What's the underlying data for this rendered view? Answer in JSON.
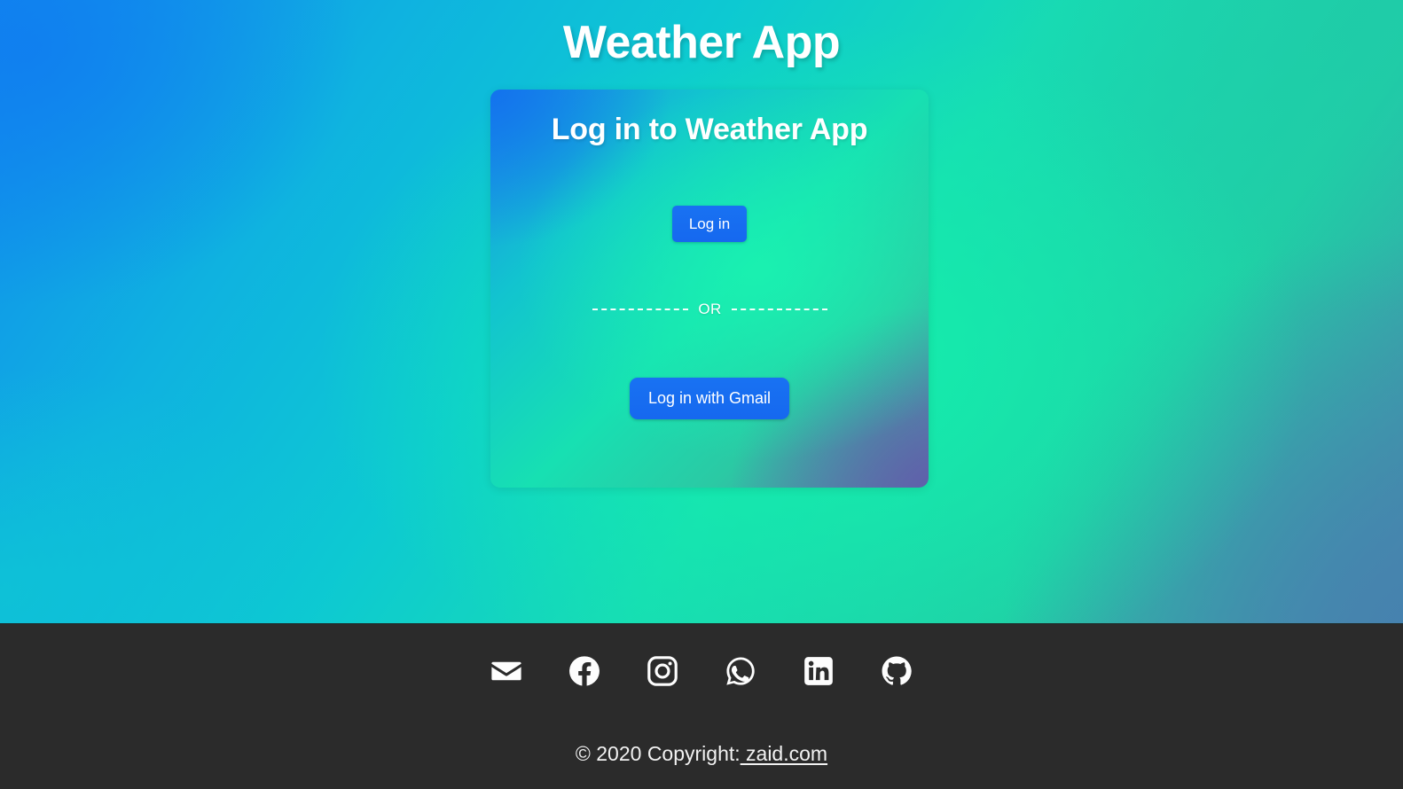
{
  "page": {
    "title": "Weather App"
  },
  "theme": {
    "accent_blue": "#1872f2",
    "footer_bg": "#2b2b2b",
    "gradient_top_left": "#1189ee",
    "gradient_top_right": "#1fcaa8",
    "gradient_bottom_left": "#0ec6d4",
    "gradient_bottom_right": "#4a86ab",
    "text_on_dark": "#f2f2f2"
  },
  "login_card": {
    "heading": "Log in to Weather App",
    "login_button_label": "Log in",
    "divider_label": "OR",
    "gmail_button_label": "Log in with Gmail"
  },
  "footer": {
    "social": [
      {
        "name": "email-icon",
        "label": "Email"
      },
      {
        "name": "facebook-icon",
        "label": "Facebook"
      },
      {
        "name": "instagram-icon",
        "label": "Instagram"
      },
      {
        "name": "whatsapp-icon",
        "label": "WhatsApp"
      },
      {
        "name": "linkedin-icon",
        "label": "LinkedIn"
      },
      {
        "name": "github-icon",
        "label": "GitHub"
      }
    ],
    "copyright_prefix": "© 2020 Copyright:",
    "copyright_link": " zaid.com"
  }
}
